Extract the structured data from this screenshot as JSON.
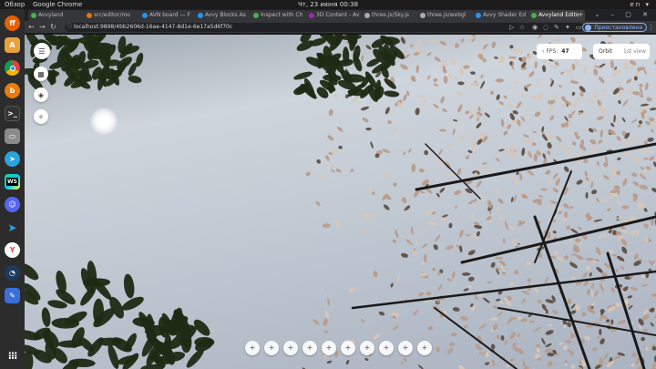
{
  "os_topbar": {
    "activities": "Обзор",
    "app_name": "Google Chrome",
    "clock": "Чт, 23 июня  00:38",
    "lang": "en"
  },
  "dock": {
    "items": [
      "firefox-icon",
      "chrome-icon",
      "software-icon",
      "blender-icon",
      "terminal-icon",
      "files-icon",
      "telegram-icon",
      "webstorm-icon",
      "discord-icon",
      "telegram-alt-icon",
      "yandex-icon",
      "clock-icon",
      "notes-icon"
    ],
    "apps_grid": "apps-grid-icon"
  },
  "browser": {
    "tabs": [
      {
        "label": "Avvyland",
        "active": false,
        "fav": "#4caf50"
      },
      {
        "label": "src/editor/mo",
        "active": false,
        "fav": "#e8710a"
      },
      {
        "label": "AVN board — F",
        "active": false,
        "fav": "#2196f3"
      },
      {
        "label": "Avvy Blocks As",
        "active": false,
        "fav": "#2196f3"
      },
      {
        "label": "Inspect with Ch",
        "active": false,
        "fav": "#4caf50"
      },
      {
        "label": "3D Content - Av",
        "active": false,
        "fav": "#9c27b0"
      },
      {
        "label": "three.js/Sky.js",
        "active": false,
        "fav": "#aaaaaa"
      },
      {
        "label": "three.js/webgl",
        "active": false,
        "fav": "#aaaaaa"
      },
      {
        "label": "Avvy Shader Ed",
        "active": false,
        "fav": "#2196f3"
      },
      {
        "label": "Avvyland Edito",
        "active": true,
        "fav": "#4caf50"
      }
    ],
    "new_tab": "+",
    "url": "localhost:9898/4bb2606d-16ae-4147-8d1e-6e17a5d6f70c",
    "profile_status": "Приостановлена"
  },
  "editor": {
    "fps_label": "FPS:",
    "fps_value": "47",
    "view_modes": [
      "Orbit",
      "1st view"
    ],
    "active_view": "Orbit",
    "left_tools": [
      "menu-icon",
      "grid-icon",
      "shapes-icon",
      "magic-icon"
    ],
    "bottom_tools": [
      "+",
      "+",
      "+",
      "+",
      "+",
      "+",
      "+",
      "+",
      "+",
      "+"
    ]
  },
  "colors": {
    "sky_top": "#9ca6b0",
    "sky_mid": "#cfd5dc",
    "leaf_dark": "#1f2a14",
    "leaf_pink": "#b89a88",
    "branch": "#1a1a1a"
  }
}
